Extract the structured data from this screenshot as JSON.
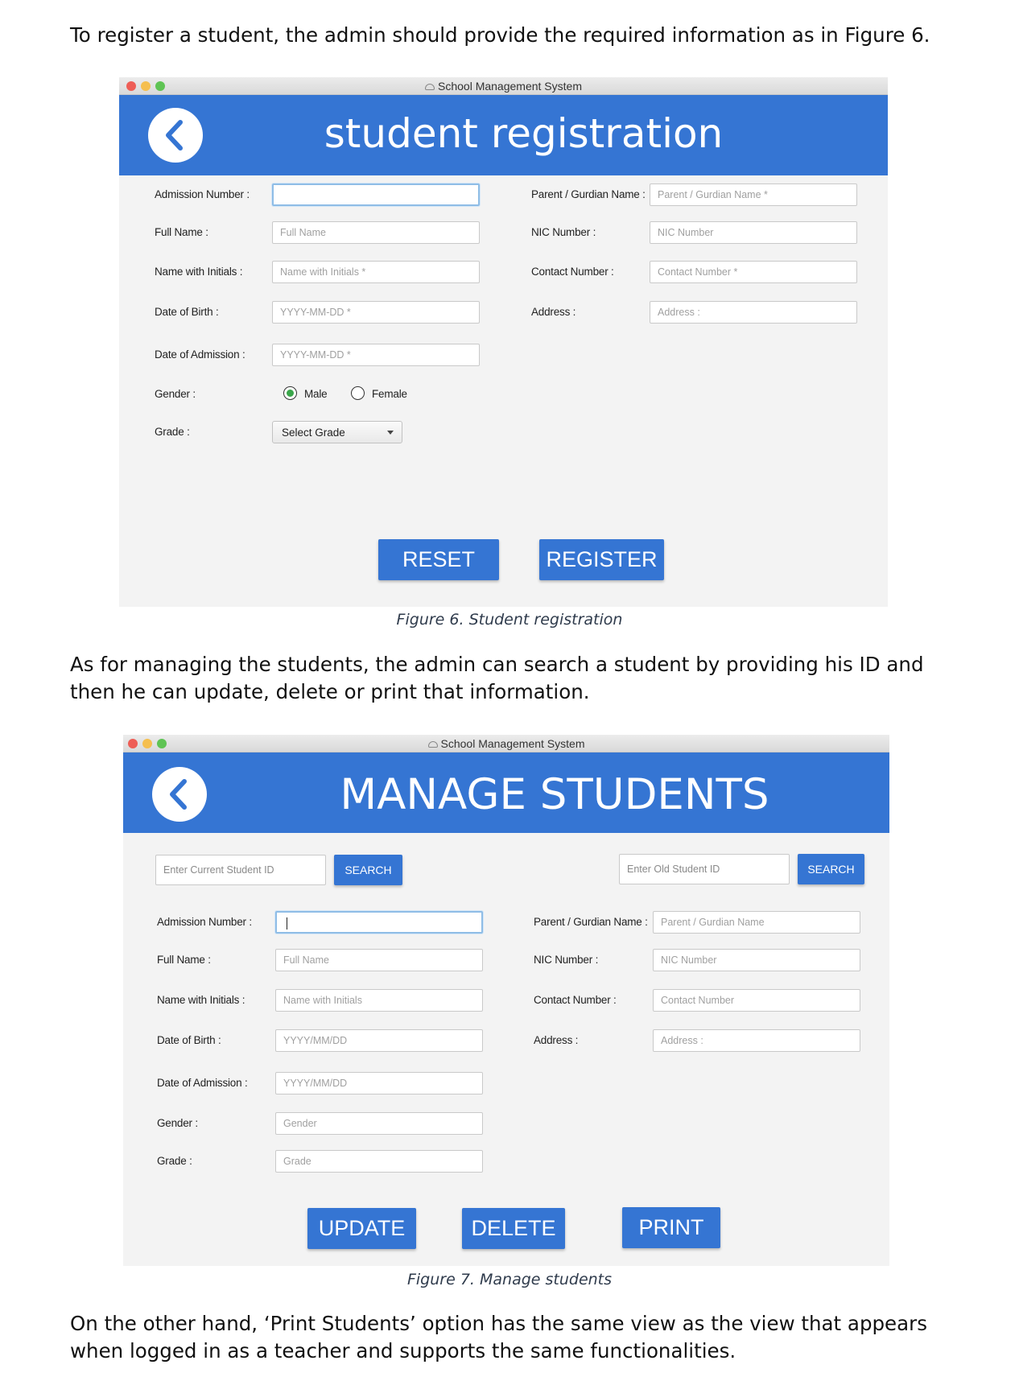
{
  "doc": {
    "intro": "To register a student, the admin should provide the required information as in Figure 6.",
    "manage_para": "As for managing the students, the admin can search a student by providing his ID and then he can update, delete or print that information.",
    "outro": "On the other hand, ‘Print Students’ option has the same view as the view that appears when logged in as a teacher and supports the same functionalities.",
    "fig6_caption": "Figure 6. Student registration",
    "fig7_caption": "Figure 7. Manage students"
  },
  "registration": {
    "window_title": "School Management System",
    "heading": "student registration",
    "labels": {
      "admission_number": "Admission Number :",
      "full_name": "Full Name :",
      "name_with_initials": "Name with Initials :",
      "date_of_birth": "Date of Birth :",
      "date_of_admission": "Date of Admission :",
      "gender": "Gender :",
      "grade": "Grade :",
      "parent_name": "Parent / Gurdian Name :",
      "nic_number": "NIC Number :",
      "contact_number": "Contact Number :",
      "address": "Address :"
    },
    "placeholders": {
      "admission_number": "",
      "full_name": "Full Name",
      "name_with_initials": "Name with Initials *",
      "date_of_birth": "YYYY-MM-DD *",
      "date_of_admission": "YYYY-MM-DD *",
      "parent_name": "Parent / Gurdian Name *",
      "nic_number": "NIC Number",
      "contact_number": "Contact Number *",
      "address": "Address :"
    },
    "gender_options": [
      "Male",
      "Female"
    ],
    "gender_selected": "Male",
    "grade_select": "Select Grade",
    "buttons": {
      "reset": "RESET",
      "register": "REGISTER"
    }
  },
  "manage": {
    "window_title": "School Management System",
    "heading": "MANAGE STUDENTS",
    "search_current_placeholder": "Enter Current Student ID",
    "search_old_placeholder": "Enter Old Student ID",
    "search_label": "SEARCH",
    "labels": {
      "admission_number": "Admission Number :",
      "full_name": "Full Name :",
      "name_with_initials": "Name with Initials :",
      "date_of_birth": "Date of Birth :",
      "date_of_admission": "Date of Admission :",
      "gender": "Gender :",
      "grade": "Grade :",
      "parent_name": "Parent / Gurdian Name :",
      "nic_number": "NIC Number :",
      "contact_number": "Contact Number :",
      "address": "Address :"
    },
    "placeholders": {
      "admission_number": "",
      "full_name": "Full Name",
      "name_with_initials": "Name with Initials",
      "date_of_birth": "YYYY/MM/DD",
      "date_of_admission": "YYYY/MM/DD",
      "gender": "Gender",
      "grade": "Grade",
      "parent_name": "Parent / Gurdian Name",
      "nic_number": "NIC Number",
      "contact_number": "Contact Number",
      "address": "Address :"
    },
    "buttons": {
      "update": "UPDATE",
      "delete": "DELETE",
      "print": "PRINT"
    }
  },
  "colors": {
    "banner": "#3575d3",
    "button": "#3575d3",
    "window_bg": "#f3f3f3"
  },
  "icons": {
    "back": "chevron-left-icon",
    "lock": "lock-icon"
  }
}
